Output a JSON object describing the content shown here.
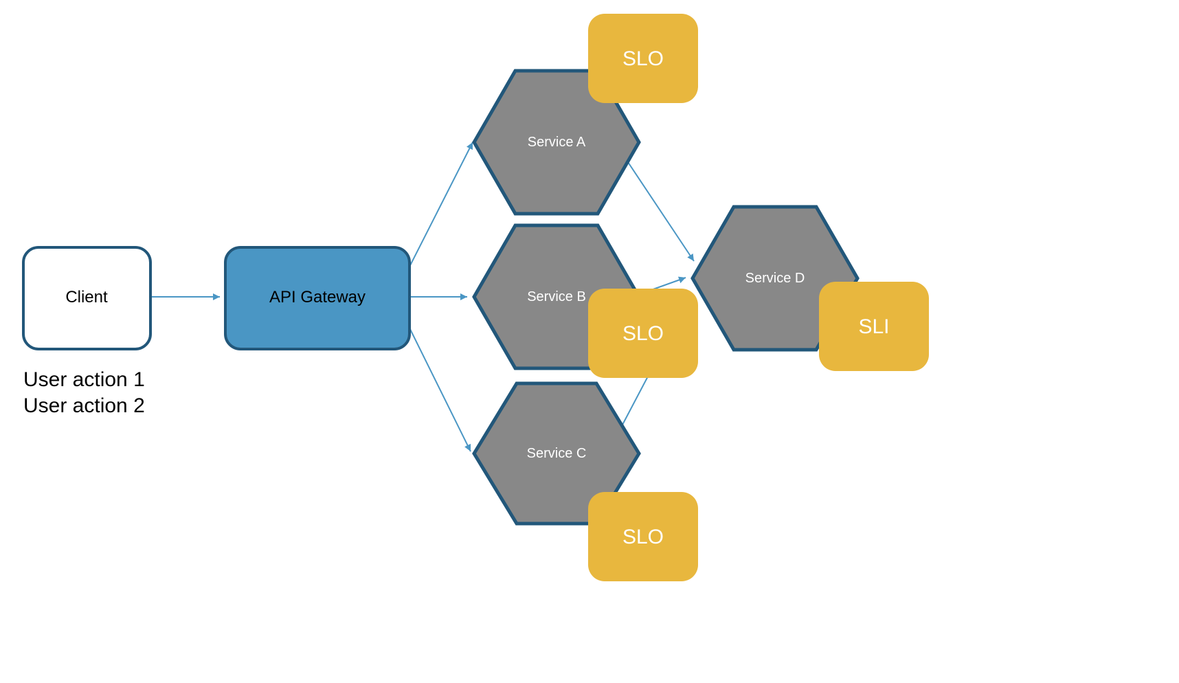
{
  "nodes": {
    "client": {
      "label": "Client"
    },
    "gateway": {
      "label": "API Gateway"
    },
    "serviceA": {
      "label": "Service A"
    },
    "serviceB": {
      "label": "Service B"
    },
    "serviceC": {
      "label": "Service C"
    },
    "serviceD": {
      "label": "Service D"
    }
  },
  "badges": {
    "sloA": {
      "label": "SLO"
    },
    "sloB": {
      "label": "SLO"
    },
    "sloC": {
      "label": "SLO"
    },
    "sliD": {
      "label": "SLI"
    }
  },
  "actions": {
    "line1": "User action 1",
    "line2": "User action 2"
  },
  "colors": {
    "outline": "#22577a",
    "gatewayFill": "#4a96c4",
    "serviceFill": "#888888",
    "badgeFill": "#e8b73e",
    "arrow": "#4a96c4"
  }
}
